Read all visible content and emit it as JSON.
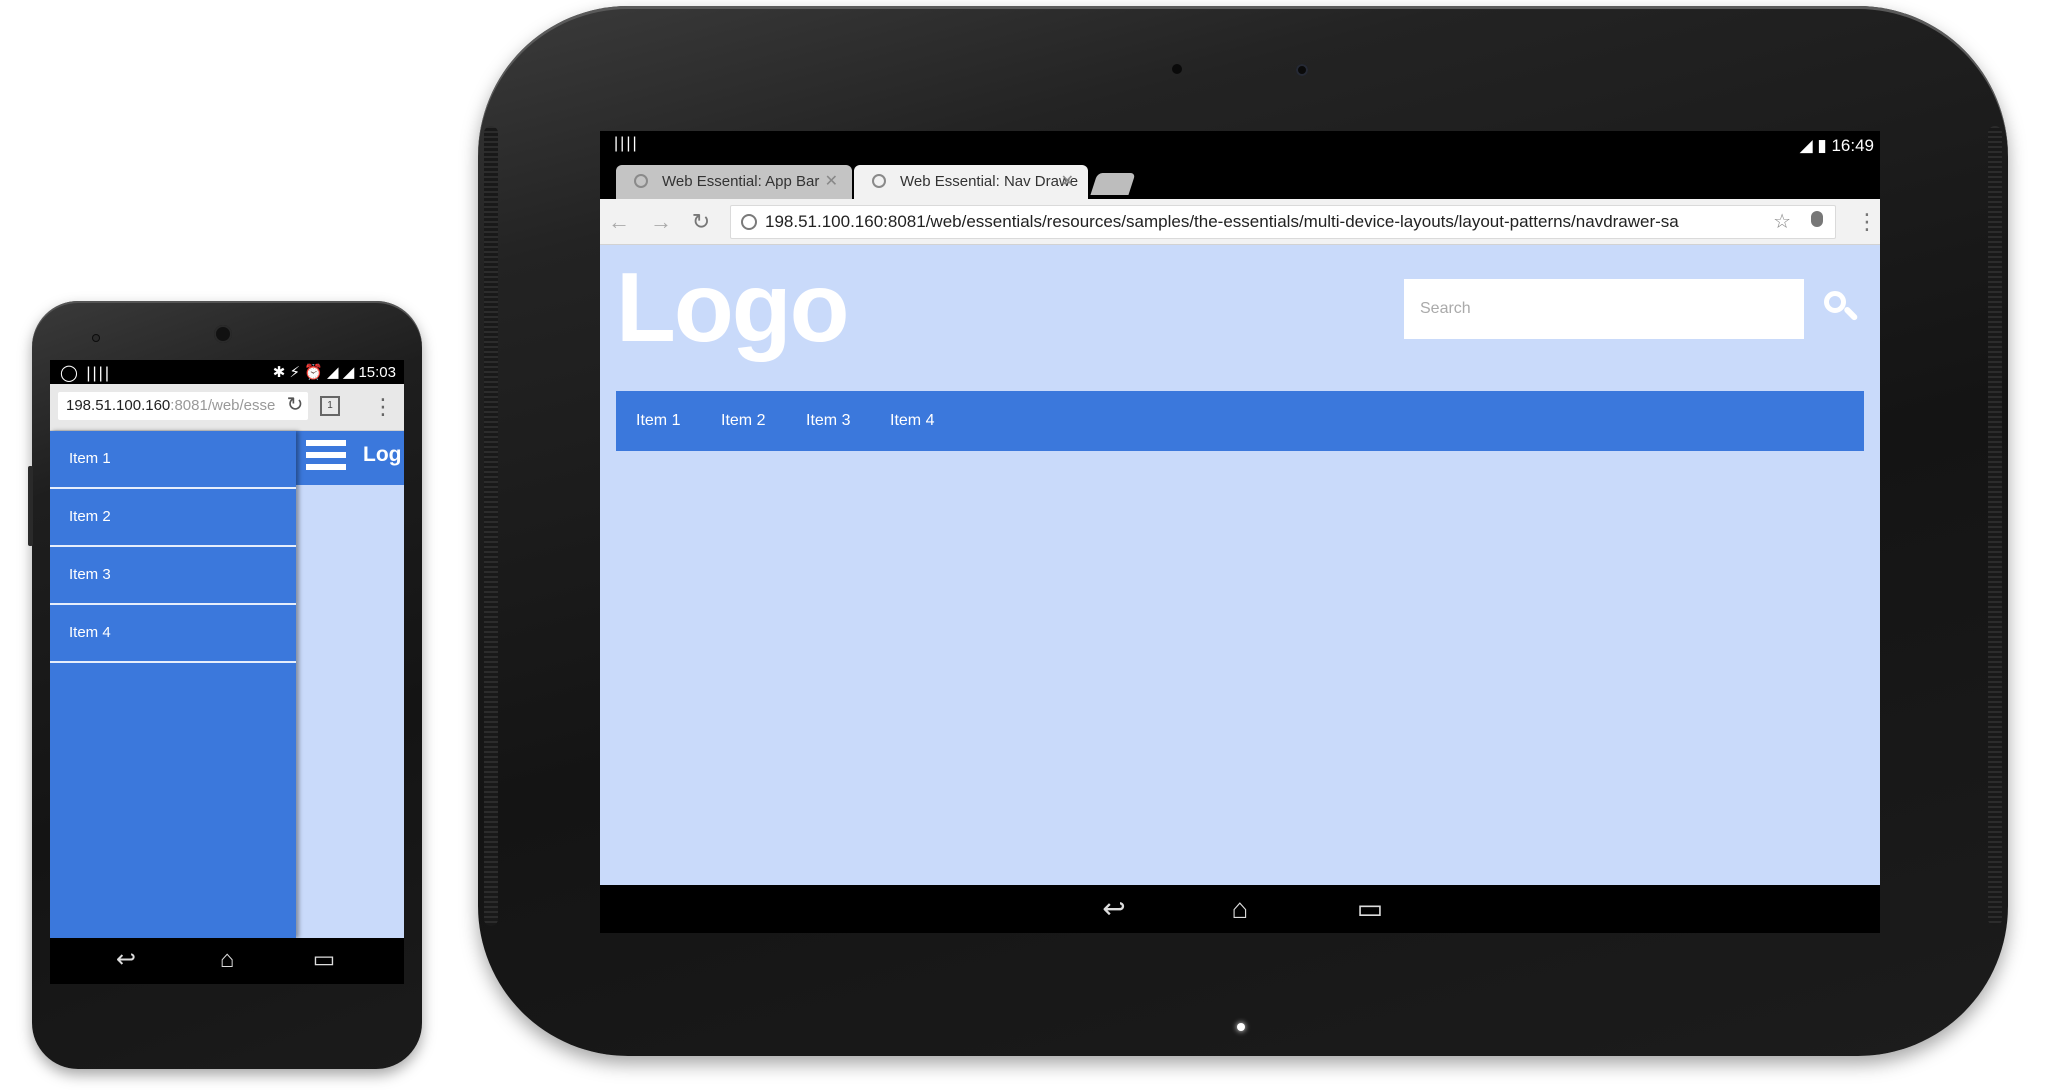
{
  "phone": {
    "status_left": "◯ ||||",
    "status_right": "✱ ⚡ ⏰ ◢ ◢ 15:03",
    "url_host": "198.51.100.160",
    "url_tail": ":8081/web/esse",
    "tab_count": "1",
    "drawer_items": [
      "Item 1",
      "Item 2",
      "Item 3",
      "Item 4"
    ],
    "logo": "Log",
    "nav_back": "↩",
    "nav_home": "⌂",
    "nav_recent": "▭"
  },
  "tablet": {
    "status_left": "||||",
    "status_right": "◢ ▮ 16:49",
    "tabs": [
      {
        "label": "Web Essential: App Bar",
        "close": "✕"
      },
      {
        "label": "Web Essential: Nav Drawe",
        "close": "✕"
      }
    ],
    "url": "198.51.100.160:8081/web/essentials/resources/samples/the-essentials/multi-device-layouts/layout-patterns/navdrawer-sa",
    "back": "←",
    "forward": "→",
    "reload": "↻",
    "star": "☆",
    "menu": "⋮",
    "logo": "Logo",
    "search_placeholder": "Search",
    "nav_items": [
      "Item 1",
      "Item 2",
      "Item 3",
      "Item 4"
    ],
    "nav_back": "↩",
    "nav_home": "⌂",
    "nav_recent": "▭"
  },
  "colors": {
    "accent": "#3b78dc",
    "page_bg": "#c9dafa"
  }
}
